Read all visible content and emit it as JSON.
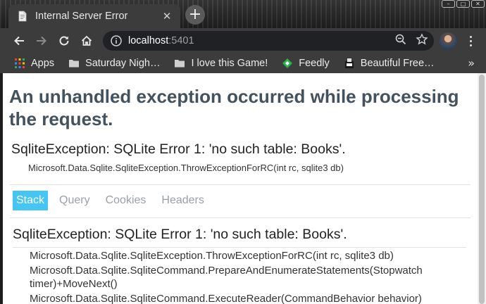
{
  "browser": {
    "tab_title": "Internal Server Error",
    "tab_close": "✕",
    "new_tab": "+",
    "url_host": "localhost",
    "url_port": ":5401",
    "window_buttons": [
      "–",
      "□",
      "✕"
    ],
    "bookmarks": [
      {
        "label": "Apps",
        "icon": "apps-grid-icon"
      },
      {
        "label": "Saturday Nigh…",
        "icon": "folder-icon"
      },
      {
        "label": "I love this Game!",
        "icon": "folder-icon"
      },
      {
        "label": "Feedly",
        "icon": "feedly-icon"
      },
      {
        "label": "Beautiful Free…",
        "icon": "bookmark-favicon-icon"
      }
    ],
    "bookmarks_more": "»"
  },
  "page": {
    "heading": "An unhandled exception occurred while processing the request.",
    "exception_title": "SqliteException: SQLite Error 1: 'no such table: Books'.",
    "exception_location": "Microsoft.Data.Sqlite.SqliteException.ThrowExceptionForRC(int rc, sqlite3 db)",
    "tabs": [
      "Stack",
      "Query",
      "Cookies",
      "Headers"
    ],
    "active_tab": "Stack",
    "stack_title": "SqliteException: SQLite Error 1: 'no such table: Books'.",
    "stack_frames": [
      "Microsoft.Data.Sqlite.SqliteException.ThrowExceptionForRC(int rc, sqlite3 db)",
      "Microsoft.Data.Sqlite.SqliteCommand.PrepareAndEnumerateStatements(Stopwatch timer)+MoveNext()",
      "Microsoft.Data.Sqlite.SqliteCommand.ExecuteReader(CommandBehavior behavior)"
    ]
  },
  "colors": {
    "active_tab": "#44c5f2",
    "heading": "#44525e",
    "chrome_dark": "#3c3c3c"
  }
}
